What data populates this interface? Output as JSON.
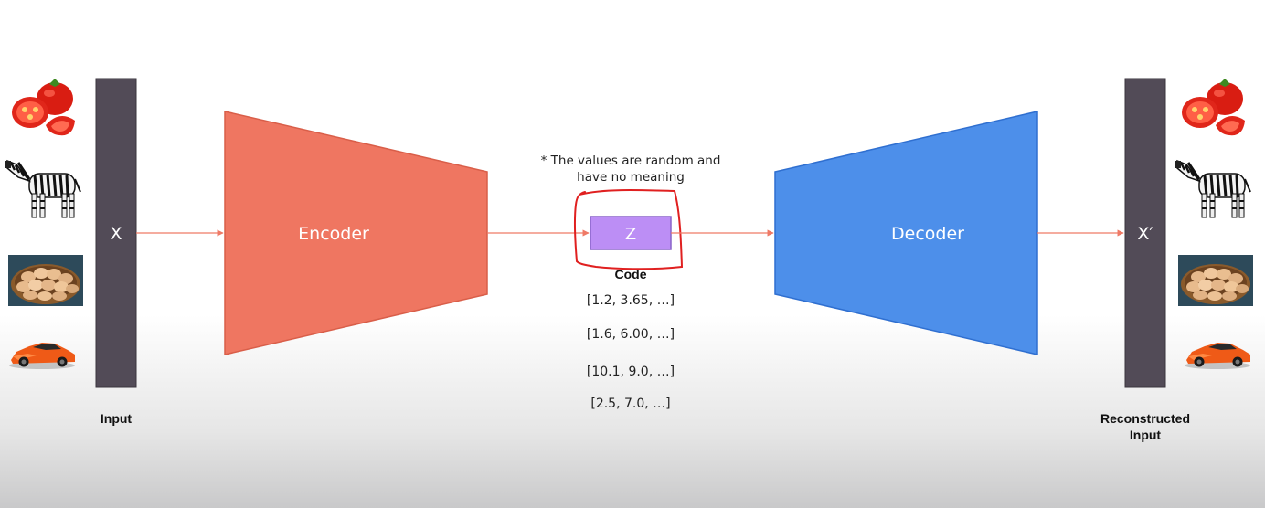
{
  "diagram": {
    "input_bar_label": "X",
    "output_bar_label": "X′",
    "encoder_label": "Encoder",
    "decoder_label": "Decoder",
    "code_box_label": "Z",
    "code_caption": "Code",
    "note_line1": "* The values are random and",
    "note_line2": "have no meaning",
    "code_values": [
      "[1.2, 3.65, …]",
      "[1.6, 6.00, …]",
      "[10.1, 9.0, …]",
      "[2.5, 7.0, …]"
    ],
    "input_caption": "Input",
    "output_caption_line1": "Reconstructed",
    "output_caption_line2": "Input",
    "example_images": [
      "tomato",
      "zebra",
      "eggs-in-basket",
      "orange-sports-car"
    ]
  },
  "colors": {
    "bar": "#524b57",
    "encoder": "#ef7661",
    "decoder": "#4d8fea",
    "code_box": "#bc8ef5",
    "arrow": "#ef7a66",
    "highlight_ink": "#e02020"
  }
}
